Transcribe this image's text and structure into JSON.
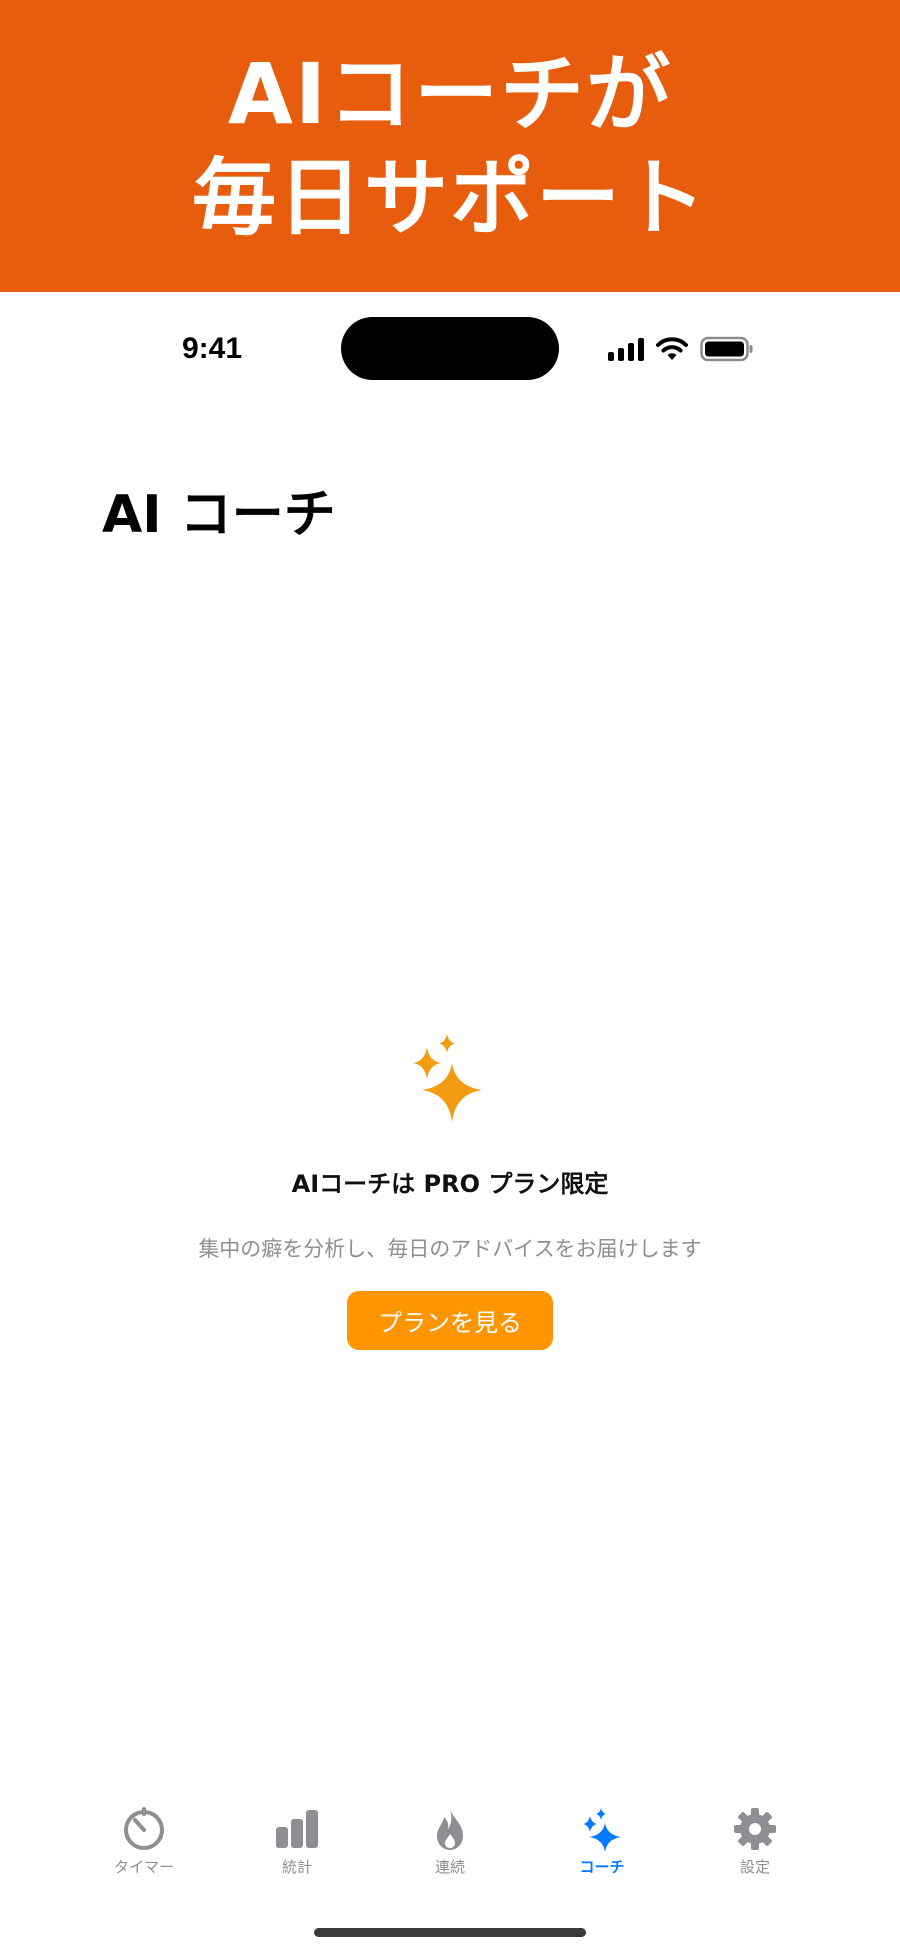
{
  "banner": {
    "line1": "AIコーチが",
    "line2": "毎日サポート",
    "bg_color": "#E85C0D"
  },
  "status_bar": {
    "time": "9:41",
    "icons": [
      "signal-icon",
      "wifi-icon",
      "battery-icon"
    ]
  },
  "page": {
    "title": "AI コーチ"
  },
  "empty_state": {
    "icon": "sparkles-icon",
    "title": "AIコーチは PRO プラン限定",
    "subtitle": "集中の癖を分析し、毎日のアドバイスをお届けします",
    "button_label": "プランを見る",
    "accent_color": "#FF9500"
  },
  "tab_bar": {
    "active_color": "#007AFF",
    "inactive_color": "#8e8e93",
    "items": [
      {
        "label": "タイマー",
        "icon": "timer-icon"
      },
      {
        "label": "統計",
        "icon": "bar-chart-icon"
      },
      {
        "label": "連続",
        "icon": "flame-icon"
      },
      {
        "label": "コーチ",
        "icon": "sparkles-icon",
        "active": true
      },
      {
        "label": "設定",
        "icon": "gear-icon"
      }
    ]
  }
}
